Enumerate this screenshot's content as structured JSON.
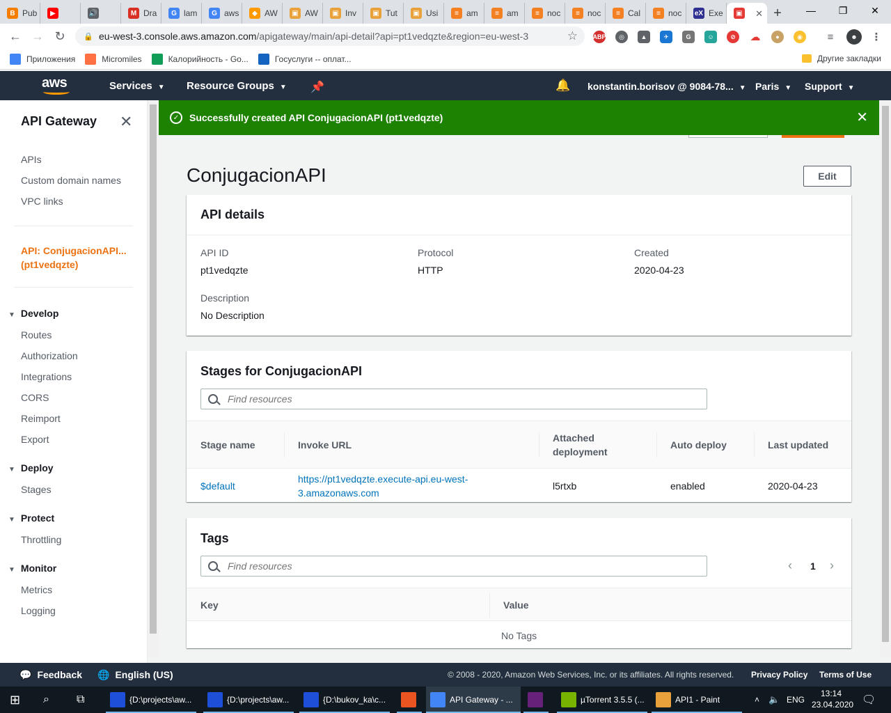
{
  "browser": {
    "tabs": [
      {
        "label": "Pub",
        "color": "#f57d00",
        "glyph": "B"
      },
      {
        "label": "",
        "color": "#ff0000",
        "glyph": "▶"
      },
      {
        "label": "",
        "color": "#5f6368",
        "glyph": "🔊"
      },
      {
        "label": "Dra",
        "color": "#d93025",
        "glyph": "M"
      },
      {
        "label": "lam",
        "color": "#4285f4",
        "glyph": "G"
      },
      {
        "label": "aws",
        "color": "#4285f4",
        "glyph": "G"
      },
      {
        "label": "AW",
        "color": "#ff9900",
        "glyph": "◆"
      },
      {
        "label": "AW",
        "color": "#e9a23b",
        "glyph": "▣"
      },
      {
        "label": "Inv",
        "color": "#e9a23b",
        "glyph": "▣"
      },
      {
        "label": "Tut",
        "color": "#e9a23b",
        "glyph": "▣"
      },
      {
        "label": "Usi",
        "color": "#e9a23b",
        "glyph": "▣"
      },
      {
        "label": "am",
        "color": "#f48024",
        "glyph": "≡"
      },
      {
        "label": "am",
        "color": "#f48024",
        "glyph": "≡"
      },
      {
        "label": "noc",
        "color": "#f48024",
        "glyph": "≡"
      },
      {
        "label": "noc",
        "color": "#f48024",
        "glyph": "≡"
      },
      {
        "label": "Cal",
        "color": "#f48024",
        "glyph": "≡"
      },
      {
        "label": "noc",
        "color": "#f48024",
        "glyph": "≡"
      },
      {
        "label": "Exe",
        "color": "#2e3192",
        "glyph": "eX"
      }
    ],
    "active_tab_close": "✕",
    "new_tab": "+",
    "url_host": "eu-west-3.console.aws.amazon.com",
    "url_path": "/apigateway/main/api-detail?api=pt1vedqzte&region=eu-west-3",
    "bookmarks": [
      {
        "label": "Приложения",
        "color": "#4285f4"
      },
      {
        "label": "Micromiles",
        "color": "#ff7043"
      },
      {
        "label": "Калорийность - Go...",
        "color": "#0f9d58"
      },
      {
        "label": "Госуслуги -- оплат...",
        "color": "#1565c0"
      }
    ],
    "other_bookmarks": "Другие закладки"
  },
  "aws_header": {
    "logo": "aws",
    "services": "Services",
    "resource_groups": "Resource Groups",
    "account": "konstantin.borisov @ 9084-78...",
    "region": "Paris",
    "support": "Support"
  },
  "sidebar": {
    "title": "API Gateway",
    "top_links": [
      "APIs",
      "Custom domain names",
      "VPC links"
    ],
    "active_api": "API: ConjugacionAPI... (pt1vedqzte)",
    "groups": [
      {
        "label": "Develop",
        "items": [
          "Routes",
          "Authorization",
          "Integrations",
          "CORS",
          "Reimport",
          "Export"
        ]
      },
      {
        "label": "Deploy",
        "items": [
          "Stages"
        ]
      },
      {
        "label": "Protect",
        "items": [
          "Throttling"
        ]
      },
      {
        "label": "Monitor",
        "items": [
          "Metrics",
          "Logging"
        ]
      }
    ]
  },
  "flash": {
    "message": "Successfully created API ConjugacionAPI (pt1vedqzte)",
    "color": "#1d8102"
  },
  "page": {
    "title": "ConjugacionAPI",
    "edit_label": "Edit"
  },
  "api_details": {
    "heading": "API details",
    "api_id_label": "API ID",
    "api_id": "pt1vedqzte",
    "protocol_label": "Protocol",
    "protocol": "HTTP",
    "created_label": "Created",
    "created": "2020-04-23",
    "description_label": "Description",
    "description": "No Description"
  },
  "stages": {
    "heading": "Stages for ConjugacionAPI",
    "search_placeholder": "Find resources",
    "columns": [
      "Stage name",
      "Invoke URL",
      "Attached deployment",
      "Auto deploy",
      "Last updated"
    ],
    "rows": [
      {
        "stage_name": "$default",
        "invoke_url": "https://pt1vedqzte.execute-api.eu-west-3.amazonaws.com",
        "invoke_url_line1": "https://pt1vedqzte.execute-api.eu-west-",
        "invoke_url_line2": "3.amazonaws.com",
        "deployment": "l5rtxb",
        "auto_deploy": "enabled",
        "last_updated": "2020-04-23"
      }
    ]
  },
  "tags": {
    "heading": "Tags",
    "search_placeholder": "Find resources",
    "page_number": "1",
    "columns": [
      "Key",
      "Value"
    ],
    "empty": "No Tags"
  },
  "footer": {
    "feedback": "Feedback",
    "language": "English (US)",
    "copyright": "© 2008 - 2020, Amazon Web Services, Inc. or its affiliates. All rights reserved.",
    "privacy": "Privacy Policy",
    "terms": "Terms of Use"
  },
  "taskbar": {
    "items": [
      {
        "label": "{D:\\projects\\aw...",
        "color": "#1e4fd8"
      },
      {
        "label": "{D:\\projects\\aw...",
        "color": "#1e4fd8"
      },
      {
        "label": "{D:\\bukov_ka\\c...",
        "color": "#1e4fd8"
      },
      {
        "label": "",
        "color": "#e95420"
      },
      {
        "label": "API Gateway - ...",
        "color": "#4285f4"
      },
      {
        "label": "",
        "color": "#68217a"
      },
      {
        "label": "µTorrent 3.5.5  (...",
        "color": "#77b300"
      },
      {
        "label": "API1 - Paint",
        "color": "#e9a23b"
      }
    ],
    "lang": "ENG",
    "time": "13:14",
    "date": "23.04.2020"
  }
}
